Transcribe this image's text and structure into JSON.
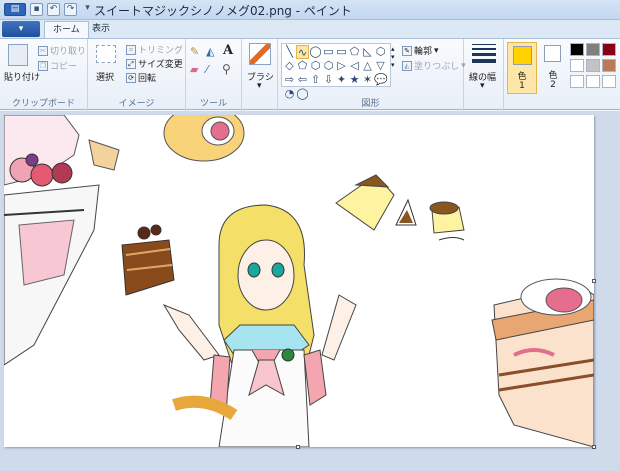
{
  "window": {
    "title": "スイートマジックシノノメグ02.png - ペイント"
  },
  "tabs": {
    "file_label": "▾",
    "home": "ホーム",
    "view": "表示"
  },
  "clipboard": {
    "paste": "貼り付け",
    "cut": "切り取り",
    "copy": "コピー",
    "group": "クリップボード"
  },
  "image": {
    "select": "選択",
    "crop": "トリミング",
    "resize": "サイズ変更",
    "rotate": "回転",
    "group": "イメージ"
  },
  "tools": {
    "group": "ツール",
    "text_tool": "A"
  },
  "brush": {
    "label": "ブラシ"
  },
  "shapes": {
    "group": "図形",
    "outline": "輪郭",
    "fill": "塗りつぶし",
    "items": [
      "╲",
      "∿",
      "◯",
      "▭",
      "▭",
      "⬠",
      "◺",
      "⬡",
      "◇",
      "⬠",
      "⬡",
      "⬡",
      "▷",
      "◁",
      "△",
      "▽",
      "⇨",
      "⇦",
      "⇧",
      "⇩",
      "✦",
      "★",
      "✶",
      "💬",
      "◔",
      "◯"
    ]
  },
  "size": {
    "label": "線の幅"
  },
  "colors": {
    "color1": "色",
    "color1_num": "1",
    "color2": "色",
    "color2_num": "2",
    "color1_value": "#ffd200",
    "color2_value": "#ffffff",
    "palette": [
      "#000000",
      "#7f7f7f",
      "#880015",
      "#ffffff",
      "#c3c3c3",
      "#b97a57",
      "#ffffff",
      "#ffffff",
      "#ffffff"
    ]
  }
}
